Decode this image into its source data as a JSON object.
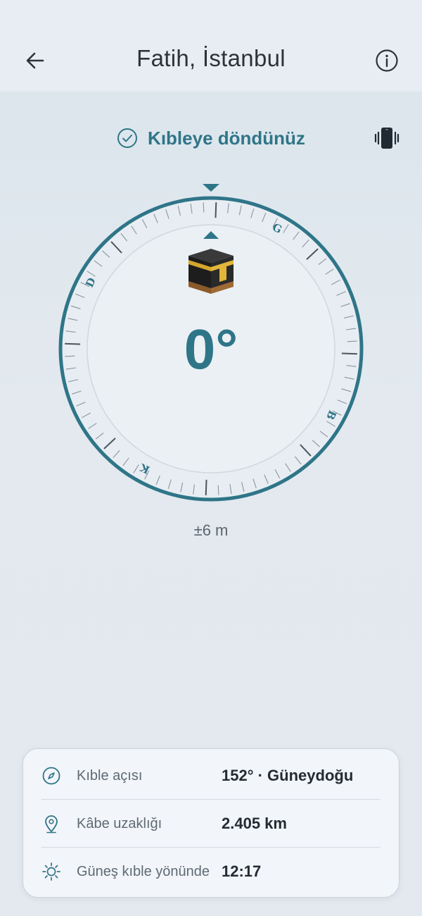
{
  "header": {
    "title": "Fatih, İstanbul",
    "back_icon": "arrow-left-icon",
    "info_icon": "info-icon"
  },
  "status": {
    "label": "Kıbleye döndünüz",
    "icon": "check-circle-icon",
    "vibrate_icon": "vibrate-phone-icon"
  },
  "compass": {
    "heading": "0°",
    "directions": {
      "north": "G",
      "east": "B",
      "south": "K",
      "west": "D"
    },
    "accent_color": "#2f7588"
  },
  "accuracy": "±6 m",
  "info": [
    {
      "icon": "compass-icon",
      "label": "Kıble açısı",
      "value": "152° · Güneydoğu"
    },
    {
      "icon": "location-pin-icon",
      "label": "Kâbe uzaklığı",
      "value": "2.405 km"
    },
    {
      "icon": "sun-icon",
      "label": "Güneş kıble yönünde",
      "value": "12:17"
    }
  ]
}
